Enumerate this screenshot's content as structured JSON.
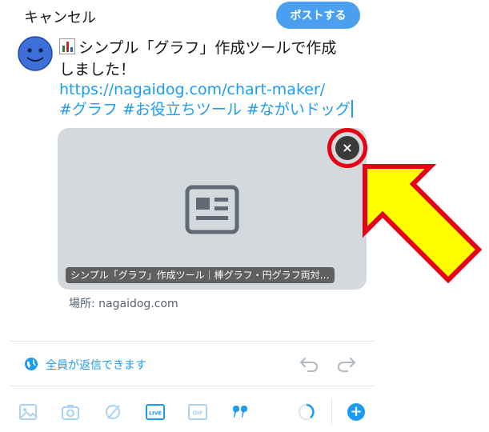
{
  "header": {
    "cancel_label": "キャンセル",
    "post_label": "ポストする"
  },
  "tweet": {
    "line1": "シンプル「グラフ」作成ツールで作成",
    "line2": "しました！",
    "link": "https://nagaidog.com/chart-maker/",
    "hashtags": "#グラフ #お役立ちツール #ながいドッグ"
  },
  "card": {
    "caption": "シンプル「グラフ」作成ツール｜棒グラフ・円グラフ両対…",
    "close_symbol": "×",
    "location": "場所: nagaidog.com"
  },
  "reply": {
    "label": "全員が返信できます"
  },
  "toolbar": {
    "add_symbol": "+",
    "icons": [
      "image-icon",
      "camera-icon",
      "circle-slash-icon",
      "live-icon",
      "gif-icon",
      "quote-icon",
      "progress-ring-icon"
    ],
    "live_label": "LIVE",
    "gif_label": "GIF"
  },
  "colors": {
    "accent": "#1d9bf0",
    "post_button": "#4a9ff0",
    "highlight": "#e60012",
    "arrow_fill": "#ffff00",
    "card_bg": "#d4d9de"
  }
}
